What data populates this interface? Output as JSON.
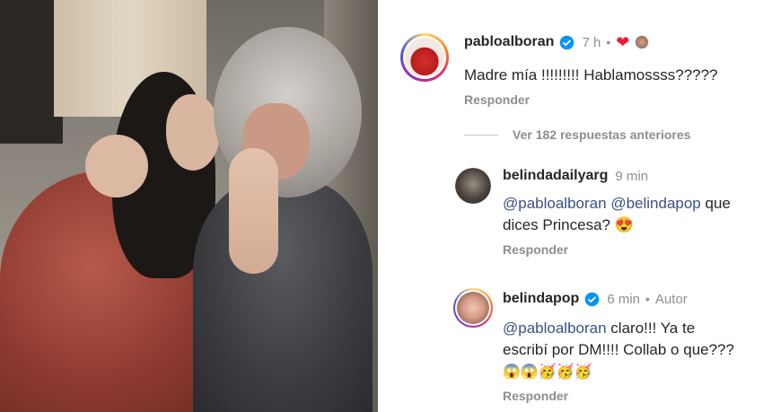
{
  "photo": {
    "description_icon": "photo"
  },
  "comments": [
    {
      "username": "pabloalboran",
      "verified": true,
      "time": "7 h",
      "liked_by_author": true,
      "text": "Madre mía !!!!!!!!! Hablamossss?????",
      "reply_label": "Responder"
    }
  ],
  "view_replies_label": "Ver 182 respuestas anteriores",
  "replies": [
    {
      "username": "belindadailyarg",
      "time": "9 min",
      "mention1": "@pabloalboran",
      "mention2": "@belindapop",
      "text_tail": " que",
      "text_line2": "dices Princesa? 😍",
      "reply_label": "Responder"
    },
    {
      "username": "belindapop",
      "verified": true,
      "time": "6 min",
      "author_label": "Autor",
      "mention": "@pabloalboran",
      "text_line1_tail": " claro!!! Ya te",
      "text_line2": "escribí por DM!!!! Collab o que???",
      "text_line3": "😱😱🥳🥳🥳",
      "reply_label": "Responder"
    }
  ],
  "colors": {
    "mention": "#385185",
    "verified": "#0095f6",
    "heart": "#ed1c3a",
    "muted": "#8e8e8e"
  }
}
